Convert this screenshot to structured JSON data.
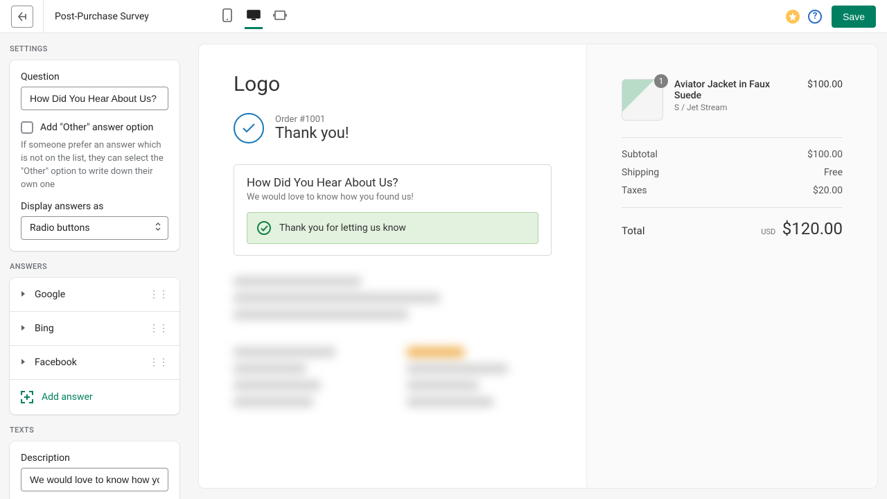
{
  "topbar": {
    "title": "Post-Purchase Survey",
    "save_label": "Save"
  },
  "sidebar": {
    "settings_section": "Settings",
    "question_label": "Question",
    "question_value": "How Did You Hear About Us?",
    "other_checkbox_label": "Add \"Other\" answer option",
    "other_help": "If someone prefer an answer which is not on the list, they can select the \"Other\" option to write down their own one",
    "display_label": "Display answers as",
    "display_value": "Radio buttons",
    "answers_section": "Answers",
    "answers": [
      {
        "label": "Google"
      },
      {
        "label": "Bing"
      },
      {
        "label": "Facebook"
      }
    ],
    "add_answer_label": "Add answer",
    "texts_section": "Texts",
    "description_label": "Description",
    "description_value": "We would love to know how you"
  },
  "preview": {
    "logo": "Logo",
    "order_number": "Order #1001",
    "thank_you": "Thank you!",
    "survey_question": "How Did You Hear About Us?",
    "survey_description": "We would love to know how you found us!",
    "success_msg": "Thank you for letting us know",
    "product": {
      "qty": "1",
      "name": "Aviator Jacket in Faux Suede",
      "variant": "S / Jet Stream",
      "price": "$100.00"
    },
    "summary": {
      "subtotal_label": "Subtotal",
      "subtotal_value": "$100.00",
      "shipping_label": "Shipping",
      "shipping_value": "Free",
      "taxes_label": "Taxes",
      "taxes_value": "$20.00",
      "total_label": "Total",
      "currency": "USD",
      "total_value": "$120.00"
    }
  }
}
